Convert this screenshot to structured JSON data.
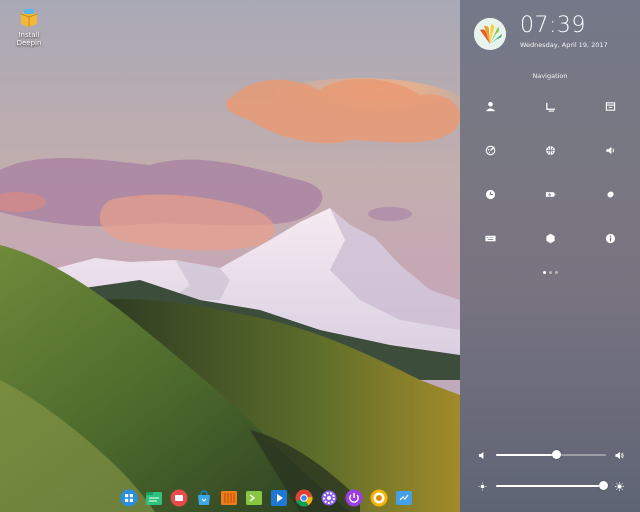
{
  "desktop": {
    "icons": [
      {
        "label_line1": "Install",
        "label_line2": "Deepin",
        "icon": "package-installer-icon"
      }
    ]
  },
  "control_center": {
    "clock": "07:39",
    "date": "Wednesday, April 19, 2017",
    "section_title": "Navigation",
    "tiles": [
      {
        "icon": "user-accounts-icon"
      },
      {
        "icon": "display-icon"
      },
      {
        "icon": "default-applications-icon"
      },
      {
        "icon": "personalization-icon"
      },
      {
        "icon": "network-icon"
      },
      {
        "icon": "sound-icon"
      },
      {
        "icon": "time-date-icon"
      },
      {
        "icon": "power-icon"
      },
      {
        "icon": "mouse-icon"
      },
      {
        "icon": "keyboard-icon"
      },
      {
        "icon": "update-icon"
      },
      {
        "icon": "system-info-icon"
      }
    ],
    "page": 1,
    "page_count": 3,
    "volume": {
      "value": 0.55,
      "icon_low": "volume-low-icon",
      "icon_high": "volume-high-icon"
    },
    "brightness": {
      "value": 0.98,
      "icon_low": "brightness-low-icon",
      "icon_high": "brightness-high-icon"
    }
  },
  "dock": {
    "items": [
      {
        "icon": "launcher-icon",
        "color": "#2a8fe0"
      },
      {
        "icon": "file-manager-icon",
        "color": "#2ec27e"
      },
      {
        "icon": "screen-recorder-icon",
        "color": "#e64b4b"
      },
      {
        "icon": "app-store-icon",
        "color": "#3aa7e8"
      },
      {
        "icon": "music-icon",
        "color": "#f07c1e"
      },
      {
        "icon": "terminal-icon",
        "color": "#88c540"
      },
      {
        "icon": "video-player-icon",
        "color": "#1f78d1"
      },
      {
        "icon": "chrome-icon",
        "color": "#db4437"
      },
      {
        "icon": "settings-icon",
        "color": "#8a5cf0"
      },
      {
        "icon": "shutdown-icon",
        "color": "#9b3fe0"
      },
      {
        "icon": "screenshot-icon",
        "color": "#f4b400"
      },
      {
        "icon": "trash-icon",
        "color": "#46a0e6"
      }
    ]
  }
}
